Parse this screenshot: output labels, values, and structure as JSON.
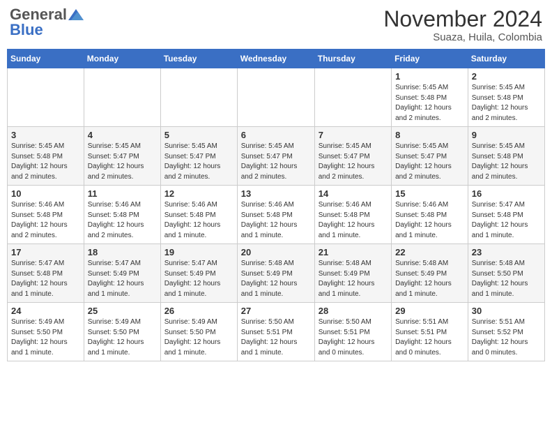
{
  "header": {
    "logo_general": "General",
    "logo_blue": "Blue",
    "month_title": "November 2024",
    "location": "Suaza, Huila, Colombia"
  },
  "calendar": {
    "days_of_week": [
      "Sunday",
      "Monday",
      "Tuesday",
      "Wednesday",
      "Thursday",
      "Friday",
      "Saturday"
    ],
    "weeks": [
      [
        {
          "day": "",
          "detail": ""
        },
        {
          "day": "",
          "detail": ""
        },
        {
          "day": "",
          "detail": ""
        },
        {
          "day": "",
          "detail": ""
        },
        {
          "day": "",
          "detail": ""
        },
        {
          "day": "1",
          "detail": "Sunrise: 5:45 AM\nSunset: 5:48 PM\nDaylight: 12 hours and 2 minutes."
        },
        {
          "day": "2",
          "detail": "Sunrise: 5:45 AM\nSunset: 5:48 PM\nDaylight: 12 hours and 2 minutes."
        }
      ],
      [
        {
          "day": "3",
          "detail": "Sunrise: 5:45 AM\nSunset: 5:48 PM\nDaylight: 12 hours and 2 minutes."
        },
        {
          "day": "4",
          "detail": "Sunrise: 5:45 AM\nSunset: 5:47 PM\nDaylight: 12 hours and 2 minutes."
        },
        {
          "day": "5",
          "detail": "Sunrise: 5:45 AM\nSunset: 5:47 PM\nDaylight: 12 hours and 2 minutes."
        },
        {
          "day": "6",
          "detail": "Sunrise: 5:45 AM\nSunset: 5:47 PM\nDaylight: 12 hours and 2 minutes."
        },
        {
          "day": "7",
          "detail": "Sunrise: 5:45 AM\nSunset: 5:47 PM\nDaylight: 12 hours and 2 minutes."
        },
        {
          "day": "8",
          "detail": "Sunrise: 5:45 AM\nSunset: 5:47 PM\nDaylight: 12 hours and 2 minutes."
        },
        {
          "day": "9",
          "detail": "Sunrise: 5:45 AM\nSunset: 5:48 PM\nDaylight: 12 hours and 2 minutes."
        }
      ],
      [
        {
          "day": "10",
          "detail": "Sunrise: 5:46 AM\nSunset: 5:48 PM\nDaylight: 12 hours and 2 minutes."
        },
        {
          "day": "11",
          "detail": "Sunrise: 5:46 AM\nSunset: 5:48 PM\nDaylight: 12 hours and 2 minutes."
        },
        {
          "day": "12",
          "detail": "Sunrise: 5:46 AM\nSunset: 5:48 PM\nDaylight: 12 hours and 1 minute."
        },
        {
          "day": "13",
          "detail": "Sunrise: 5:46 AM\nSunset: 5:48 PM\nDaylight: 12 hours and 1 minute."
        },
        {
          "day": "14",
          "detail": "Sunrise: 5:46 AM\nSunset: 5:48 PM\nDaylight: 12 hours and 1 minute."
        },
        {
          "day": "15",
          "detail": "Sunrise: 5:46 AM\nSunset: 5:48 PM\nDaylight: 12 hours and 1 minute."
        },
        {
          "day": "16",
          "detail": "Sunrise: 5:47 AM\nSunset: 5:48 PM\nDaylight: 12 hours and 1 minute."
        }
      ],
      [
        {
          "day": "17",
          "detail": "Sunrise: 5:47 AM\nSunset: 5:48 PM\nDaylight: 12 hours and 1 minute."
        },
        {
          "day": "18",
          "detail": "Sunrise: 5:47 AM\nSunset: 5:49 PM\nDaylight: 12 hours and 1 minute."
        },
        {
          "day": "19",
          "detail": "Sunrise: 5:47 AM\nSunset: 5:49 PM\nDaylight: 12 hours and 1 minute."
        },
        {
          "day": "20",
          "detail": "Sunrise: 5:48 AM\nSunset: 5:49 PM\nDaylight: 12 hours and 1 minute."
        },
        {
          "day": "21",
          "detail": "Sunrise: 5:48 AM\nSunset: 5:49 PM\nDaylight: 12 hours and 1 minute."
        },
        {
          "day": "22",
          "detail": "Sunrise: 5:48 AM\nSunset: 5:49 PM\nDaylight: 12 hours and 1 minute."
        },
        {
          "day": "23",
          "detail": "Sunrise: 5:48 AM\nSunset: 5:50 PM\nDaylight: 12 hours and 1 minute."
        }
      ],
      [
        {
          "day": "24",
          "detail": "Sunrise: 5:49 AM\nSunset: 5:50 PM\nDaylight: 12 hours and 1 minute."
        },
        {
          "day": "25",
          "detail": "Sunrise: 5:49 AM\nSunset: 5:50 PM\nDaylight: 12 hours and 1 minute."
        },
        {
          "day": "26",
          "detail": "Sunrise: 5:49 AM\nSunset: 5:50 PM\nDaylight: 12 hours and 1 minute."
        },
        {
          "day": "27",
          "detail": "Sunrise: 5:50 AM\nSunset: 5:51 PM\nDaylight: 12 hours and 1 minute."
        },
        {
          "day": "28",
          "detail": "Sunrise: 5:50 AM\nSunset: 5:51 PM\nDaylight: 12 hours and 0 minutes."
        },
        {
          "day": "29",
          "detail": "Sunrise: 5:51 AM\nSunset: 5:51 PM\nDaylight: 12 hours and 0 minutes."
        },
        {
          "day": "30",
          "detail": "Sunrise: 5:51 AM\nSunset: 5:52 PM\nDaylight: 12 hours and 0 minutes."
        }
      ]
    ]
  },
  "colors": {
    "header_bg": "#3a6fc4",
    "header_text": "#ffffff"
  }
}
